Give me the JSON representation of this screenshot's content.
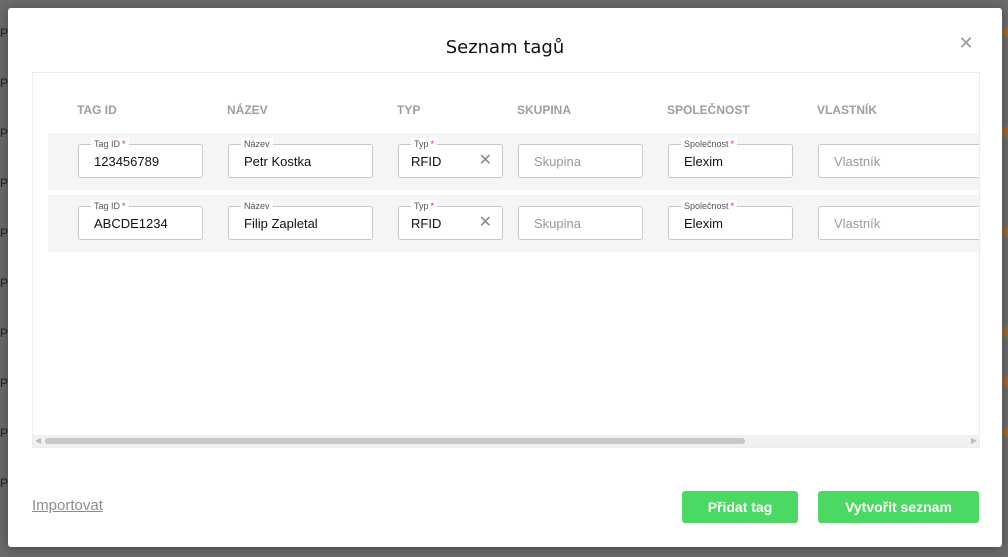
{
  "modal": {
    "title": "Seznam tagů",
    "close_icon": "close-icon"
  },
  "background": {
    "letter": "P"
  },
  "table": {
    "columns": [
      "TAG ID",
      "NÁZEV",
      "TYP",
      "SKUPINA",
      "SPOLEČNOST",
      "VLASTNÍK"
    ],
    "field_labels": {
      "tag_id": "Tag ID",
      "name": "Název",
      "type": "Typ",
      "company": "Společnost"
    },
    "required_mark": "*",
    "rows": [
      {
        "tag_id": "123456789",
        "name": "Petr Kostka",
        "type": "RFID",
        "group_placeholder": "Skupina",
        "company": "Elexim",
        "owner_placeholder": "Vlastník"
      },
      {
        "tag_id": "ABCDE1234",
        "name": "Filip Zapletal",
        "type": "RFID",
        "group_placeholder": "Skupina",
        "company": "Elexim",
        "owner_placeholder": "Vlastník"
      }
    ]
  },
  "footer": {
    "import_label": "Importovat",
    "add_tag_label": "Přidat tag",
    "create_list_label": "Vytvořit seznam"
  },
  "colors": {
    "primary_button": "#4cd963",
    "required": "#e0262b"
  }
}
